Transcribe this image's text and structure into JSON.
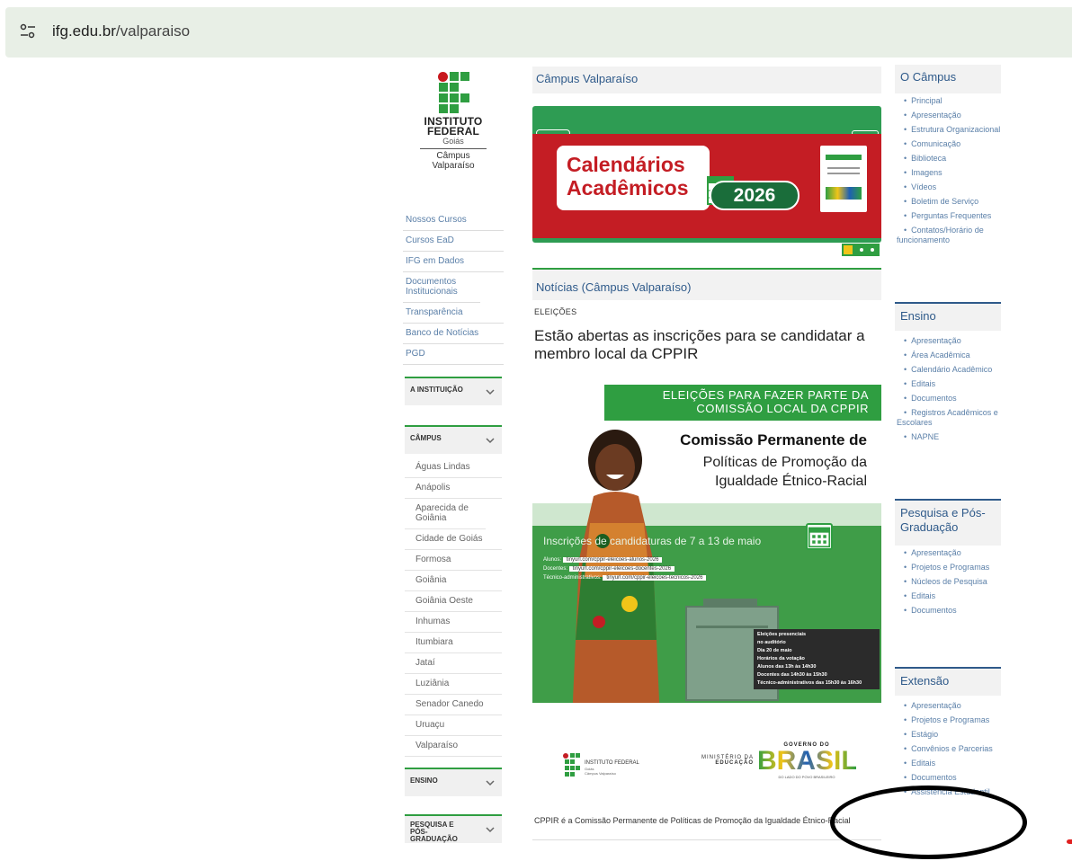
{
  "browser": {
    "url_host": "ifg.edu.br",
    "url_path": "/valparaiso"
  },
  "logo": {
    "line1": "INSTITUTO",
    "line2": "FEDERAL",
    "line3": "Goiás",
    "line4": "Câmpus",
    "line5": "Valparaíso"
  },
  "left_nav": [
    "Nossos Cursos",
    "Cursos EaD",
    "IFG em Dados",
    "Documentos Institucionais",
    "Transparência",
    "Banco de Notícias",
    "PGD"
  ],
  "sections": {
    "instituicao": "A INSTITUIÇÃO",
    "campus": "CÂMPUS",
    "ensino": "ENSINO",
    "pesquisa": "PESQUISA E PÓS-GRADUAÇÃO"
  },
  "campus_list": [
    "Águas Lindas",
    "Anápolis",
    "Aparecida de Goiânia",
    "Cidade de Goiás",
    "Formosa",
    "Goiânia",
    "Goiânia Oeste",
    "Inhumas",
    "Itumbiara",
    "Jataí",
    "Luziânia",
    "Senador Canedo",
    "Uruaçu",
    "Valparaíso"
  ],
  "center": {
    "campus_title": "Câmpus Valparaíso",
    "banner": {
      "line1": "Calendários",
      "line2": "Acadêmicos",
      "year": "2026"
    },
    "news_title": "Notícias (Câmpus Valparaíso)",
    "kicker": "ELEIÇÕES",
    "headline": "Estão abertas as inscrições para se candidatar a membro local da CPPIR",
    "poster": {
      "top_bar": "ELEIÇÕES PARA FAZER PARTE DA COMISSÃO LOCAL DA CPPIR",
      "title_bold": "Comissão Permanente de",
      "title_rest": "Políticas de Promoção da Igualdade Étnico-Racial",
      "inscricoes": "Inscrições de candidaturas de 7 a 13 de maio",
      "link1_label": "Alunos:",
      "link1": "tinyurl.com/cppir-eleicoes-alunos-2026",
      "link2_label": "Docentes:",
      "link2": "tinyurl.com/cppir-eleicoes-docentes-2026",
      "link3_label": "Técnico-administrativos:",
      "link3": "tinyurl.com/cppir-eleicoes-tecnicos-2026",
      "info1": "Eleições presenciais",
      "info2": "no auditório",
      "info3": "Dia 20 de maio",
      "info4": "Horários da votação",
      "info5": "Alunos das 13h às 14h30",
      "info6": "Docentes das 14h30 às 15h30",
      "info7": "Técnico-administrativos das 15h30 às 16h30"
    },
    "logos": {
      "ifg": "INSTITUTO FEDERAL",
      "ifg_sub1": "Goiás",
      "ifg_sub2": "Câmpus Valparaíso",
      "mec1": "MINISTÉRIO DA",
      "mec2": "EDUCAÇÃO",
      "gov1": "GOVERNO DO",
      "gov2": "BRASIL",
      "gov3": "DO LADO DO POVO BRASILEIRO"
    },
    "caption": "CPPIR é a Comissão Permanente de Políticas de Promoção da Igualdade Étnico-Racial"
  },
  "right": {
    "campus": {
      "title": "O Câmpus",
      "items": [
        "Principal",
        "Apresentação",
        "Estrutura Organizacional",
        "Comunicação",
        "Biblioteca",
        "Imagens",
        "Vídeos",
        "Boletim de Serviço",
        "Perguntas Frequentes",
        "Contatos/Horário de funcionamento"
      ]
    },
    "ensino": {
      "title": "Ensino",
      "items": [
        "Apresentação",
        "Área Acadêmica",
        "Calendário Acadêmico",
        "Editais",
        "Documentos",
        "Registros Acadêmicos e Escolares",
        "NAPNE"
      ]
    },
    "pesquisa": {
      "title": "Pesquisa e Pós-Graduação",
      "items": [
        "Apresentação",
        "Projetos e Programas",
        "Núcleos de Pesquisa",
        "Editais",
        "Documentos"
      ]
    },
    "extensao": {
      "title": "Extensão",
      "items": [
        "Apresentação",
        "Projetos e Programas",
        "Estágio",
        "Convênios e Parcerias",
        "Editais",
        "Documentos",
        "Assistência Estudantil"
      ]
    }
  },
  "colors": {
    "ifg_green": "#2f9e41",
    "ifg_red": "#c41d24",
    "link_blue": "#5a7fa8"
  }
}
